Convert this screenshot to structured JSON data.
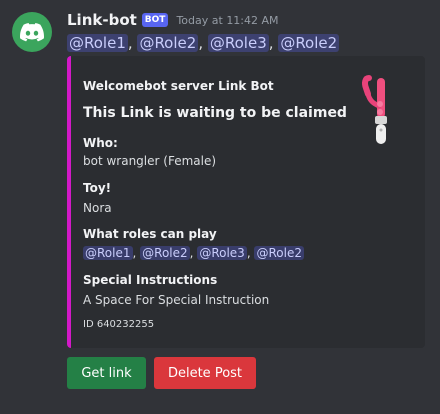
{
  "message": {
    "username": "Link-bot",
    "bot_tag": "BOT",
    "timestamp": "Today at 11:42 AM",
    "mentions": [
      "@Role1",
      "@Role2",
      "@Role3",
      "@Role2"
    ],
    "separator": ","
  },
  "embed": {
    "author": "Welcomebot server Link Bot",
    "title": "This Link is waiting to be claimed",
    "accent_color": "#d319c8",
    "thumbnail": "toy-thumbnail",
    "fields": {
      "who_name": "Who:",
      "who_value": "bot wrangler (Female)",
      "toy_name": "Toy!",
      "toy_value": "Nora",
      "roles_name": "What roles can play",
      "roles_mentions": [
        "@Role1",
        "@Role2",
        "@Role3",
        "@Role2"
      ],
      "special_name": "Special Instructions",
      "special_value": "A Space For Special Instruction"
    },
    "footer": "ID 640232255"
  },
  "buttons": {
    "get_link": "Get link",
    "delete_post": "Delete Post"
  },
  "colors": {
    "background": "#313338",
    "embed_bg": "#2b2d31",
    "success": "#248046",
    "danger": "#da373c",
    "blurple": "#5865f2"
  }
}
